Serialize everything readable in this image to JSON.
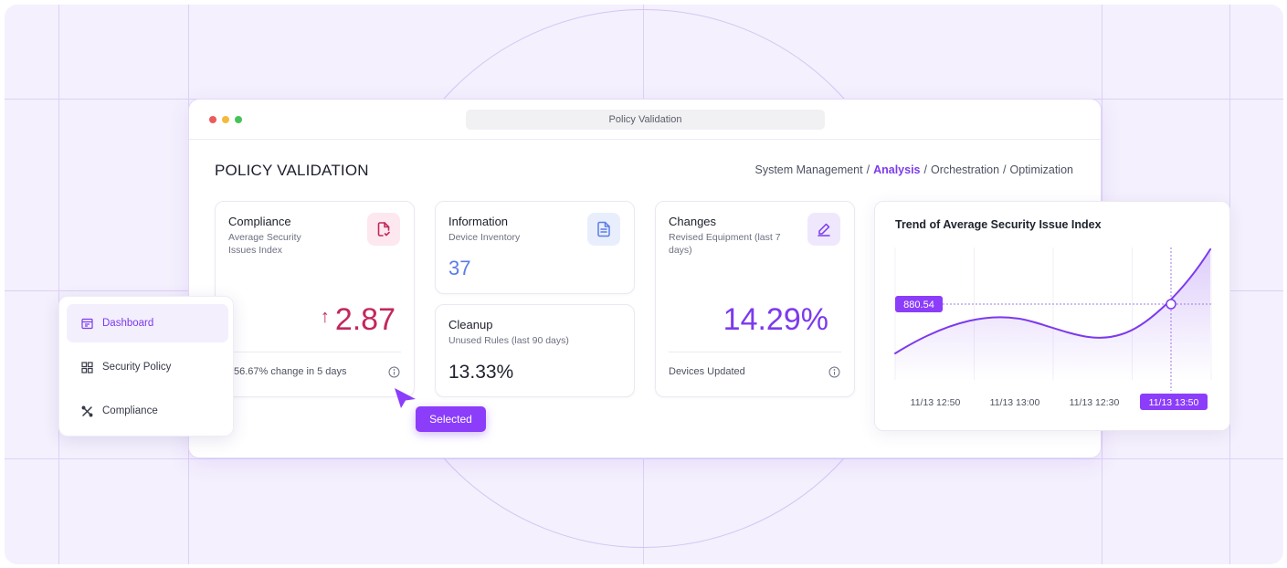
{
  "window": {
    "address_bar": "Policy Validation",
    "traffic_lights": [
      "#ec5b5b",
      "#f5b93b",
      "#46c25a"
    ]
  },
  "page": {
    "title": "POLICY VALIDATION",
    "breadcrumb": [
      {
        "label": "System Management",
        "active": false
      },
      {
        "label": "Analysis",
        "active": true
      },
      {
        "label": "Orchestration",
        "active": false
      },
      {
        "label": "Optimization",
        "active": false
      }
    ],
    "separator": "/"
  },
  "cards": {
    "compliance": {
      "title": "Compliance",
      "subtitle": "Average Security Issues Index",
      "arrow": "↑",
      "value": "2.87",
      "footer": "56.67% change in 5 days",
      "icon": "document-check-icon",
      "color": "#c2285a"
    },
    "information": {
      "title": "Information",
      "subtitle": "Device Inventory",
      "value": "37",
      "icon": "document-list-icon",
      "color": "#5b7ce8"
    },
    "cleanup": {
      "title": "Cleanup",
      "subtitle": "Unused Rules (last 90 days)",
      "value": "13.33%"
    },
    "changes": {
      "title": "Changes",
      "subtitle": "Revised Equipment (last 7 days)",
      "value": "14.29%",
      "footer": "Devices Updated",
      "icon": "pencil-icon",
      "color": "#7c3aed"
    }
  },
  "sidebar": {
    "items": [
      {
        "label": "Dashboard",
        "icon": "dashboard-icon",
        "active": true
      },
      {
        "label": "Security Policy",
        "icon": "grid-icon",
        "active": false
      },
      {
        "label": "Compliance",
        "icon": "tools-icon",
        "active": false
      }
    ]
  },
  "selection_tooltip": "Selected",
  "accent": "#7c3aed",
  "chart_data": {
    "type": "area",
    "title": "Trend of Average Security Issue Index",
    "x": [
      "11/13 12:50",
      "11/13 13:00",
      "11/13 12:30",
      "11/13 13:50"
    ],
    "highlighted_x": "11/13 13:50",
    "highlighted_value": "880.54",
    "grid": true
  }
}
